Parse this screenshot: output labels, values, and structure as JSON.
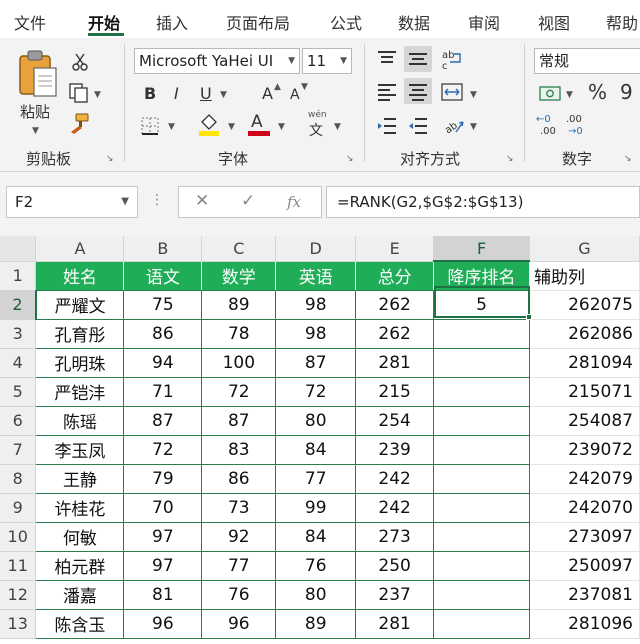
{
  "menu": {
    "tabs": [
      "文件",
      "开始",
      "插入",
      "页面布局",
      "公式",
      "数据",
      "审阅",
      "视图",
      "帮助"
    ],
    "active": "开始"
  },
  "ribbon": {
    "clipboard": {
      "paste": "粘贴",
      "group": "剪贴板"
    },
    "font": {
      "name": "Microsoft YaHei UI",
      "size": "11",
      "group": "字体",
      "bold": "B",
      "italic": "I",
      "underline": "U",
      "grow": "A",
      "shrink": "A",
      "color_letter": "A",
      "phonetic_top": "wén",
      "phonetic_bottom": "文"
    },
    "alignment": {
      "group": "对齐方式"
    },
    "number": {
      "format": "常规",
      "group": "数字",
      "percent": "%",
      "comma": "9"
    },
    "colors": {
      "fill": "#ffe600",
      "font": "#d0021b",
      "accent": "#1f7244"
    }
  },
  "formula_bar": {
    "name_box": "F2",
    "cancel": "✕",
    "enter": "✓",
    "fx": "fx",
    "formula": "=RANK(G2,$G$2:$G$13)"
  },
  "sheet": {
    "columns": [
      "A",
      "B",
      "C",
      "D",
      "E",
      "F",
      "G"
    ],
    "selected_column": "F",
    "selected_row": "2",
    "selected_cell": "F2",
    "headers": [
      "姓名",
      "语文",
      "数学",
      "英语",
      "总分",
      "降序排名",
      "辅助列"
    ],
    "rows": [
      {
        "n": "2",
        "cells": [
          "严耀文",
          "75",
          "89",
          "98",
          "262",
          "5",
          "262075"
        ]
      },
      {
        "n": "3",
        "cells": [
          "孔育彤",
          "86",
          "78",
          "98",
          "262",
          "",
          "262086"
        ]
      },
      {
        "n": "4",
        "cells": [
          "孔明珠",
          "94",
          "100",
          "87",
          "281",
          "",
          "281094"
        ]
      },
      {
        "n": "5",
        "cells": [
          "严铠沣",
          "71",
          "72",
          "72",
          "215",
          "",
          "215071"
        ]
      },
      {
        "n": "6",
        "cells": [
          "陈瑶",
          "87",
          "87",
          "80",
          "254",
          "",
          "254087"
        ]
      },
      {
        "n": "7",
        "cells": [
          "李玉凤",
          "72",
          "83",
          "84",
          "239",
          "",
          "239072"
        ]
      },
      {
        "n": "8",
        "cells": [
          "王静",
          "79",
          "86",
          "77",
          "242",
          "",
          "242079"
        ]
      },
      {
        "n": "9",
        "cells": [
          "许桂花",
          "70",
          "73",
          "99",
          "242",
          "",
          "242070"
        ]
      },
      {
        "n": "10",
        "cells": [
          "何敏",
          "97",
          "92",
          "84",
          "273",
          "",
          "273097"
        ]
      },
      {
        "n": "11",
        "cells": [
          "柏元群",
          "97",
          "77",
          "76",
          "250",
          "",
          "250097"
        ]
      },
      {
        "n": "12",
        "cells": [
          "潘嘉",
          "81",
          "76",
          "80",
          "237",
          "",
          "237081"
        ]
      },
      {
        "n": "13",
        "cells": [
          "陈含玉",
          "96",
          "96",
          "89",
          "281",
          "",
          "281096"
        ]
      }
    ],
    "header_row_number": "1"
  }
}
